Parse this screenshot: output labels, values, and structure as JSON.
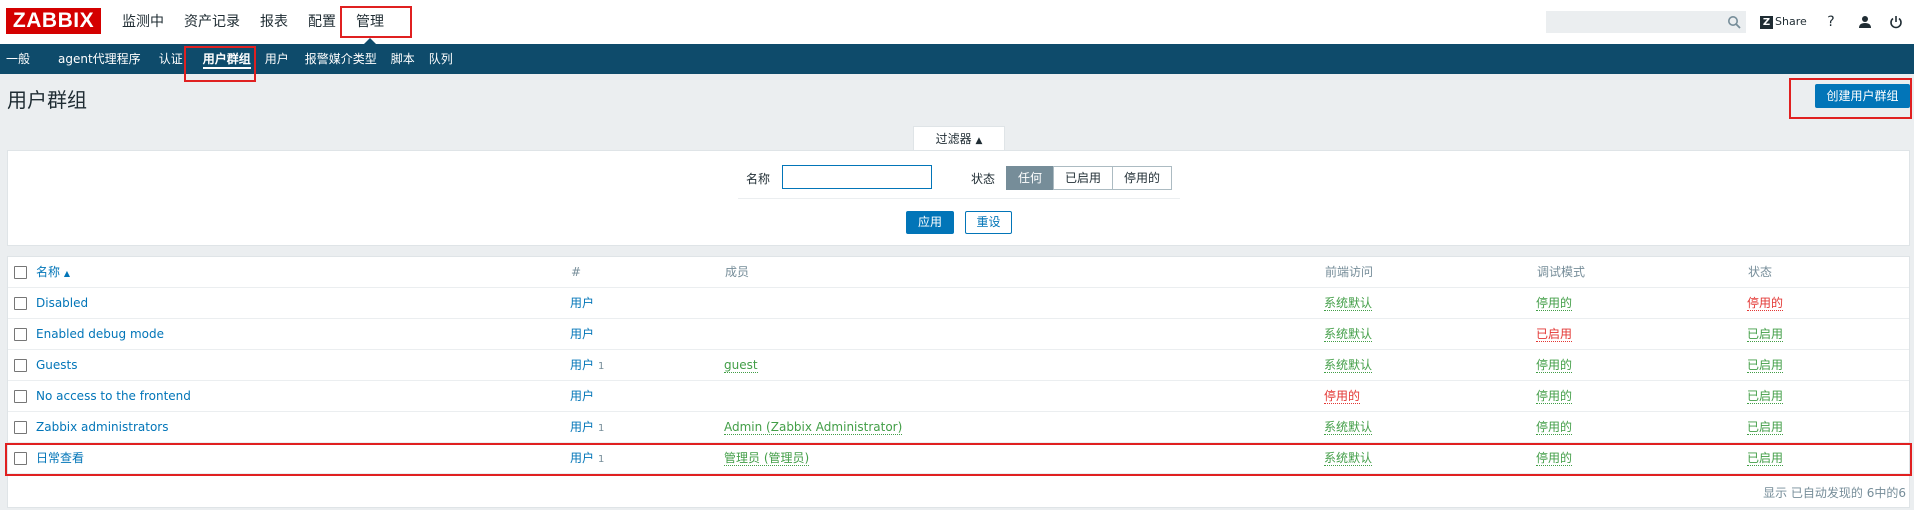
{
  "header": {
    "logo": "ZABBIX",
    "menu": [
      "监测中",
      "资产记录",
      "报表",
      "配置",
      "管理"
    ],
    "share": "Share",
    "share_mark": "Z",
    "help": "?"
  },
  "subnav": [
    "一般",
    "agent代理程序",
    "认证",
    "用户群组",
    "用户",
    "报警媒介类型",
    "脚本",
    "队列"
  ],
  "page": {
    "title": "用户群组",
    "create_button": "创建用户群组"
  },
  "filter": {
    "tab_label": "过滤器",
    "name_label": "名称",
    "name_value": "",
    "status_label": "状态",
    "status_options": [
      "任何",
      "已启用",
      "停用的"
    ],
    "status_selected": "任何",
    "apply": "应用",
    "reset": "重设"
  },
  "table": {
    "columns": [
      "名称",
      "#",
      "成员",
      "前端访问",
      "调试模式",
      "状态"
    ],
    "sort_arrow": "▲",
    "rows": [
      {
        "name": "Disabled",
        "users": "用户",
        "count": "",
        "members": "",
        "frontend": "系统默认",
        "debug": "停用的",
        "status": "停用的"
      },
      {
        "name": "Enabled debug mode",
        "users": "用户",
        "count": "",
        "members": "",
        "frontend": "系统默认",
        "debug": "已启用",
        "status": "已启用"
      },
      {
        "name": "Guests",
        "users": "用户",
        "count": "1",
        "members": "guest",
        "frontend": "系统默认",
        "debug": "停用的",
        "status": "已启用"
      },
      {
        "name": "No access to the frontend",
        "users": "用户",
        "count": "",
        "members": "",
        "frontend": "停用的",
        "debug": "停用的",
        "status": "已启用"
      },
      {
        "name": "Zabbix administrators",
        "users": "用户",
        "count": "1",
        "members": "Admin (Zabbix Administrator)",
        "frontend": "系统默认",
        "debug": "停用的",
        "status": "已启用"
      },
      {
        "name": "日常查看",
        "users": "用户",
        "count": "1",
        "members": "管理员 (管理员)",
        "frontend": "系统默认",
        "debug": "停用的",
        "status": "已启用"
      }
    ],
    "footer": "显示 已自动发现的 6中的6"
  },
  "colors": {
    "brand": "#d40000",
    "nav": "#0e4b6b",
    "link": "#0275b8",
    "enabled": "#429e47",
    "disabled": "#e33734",
    "highlight": "#e02020"
  }
}
